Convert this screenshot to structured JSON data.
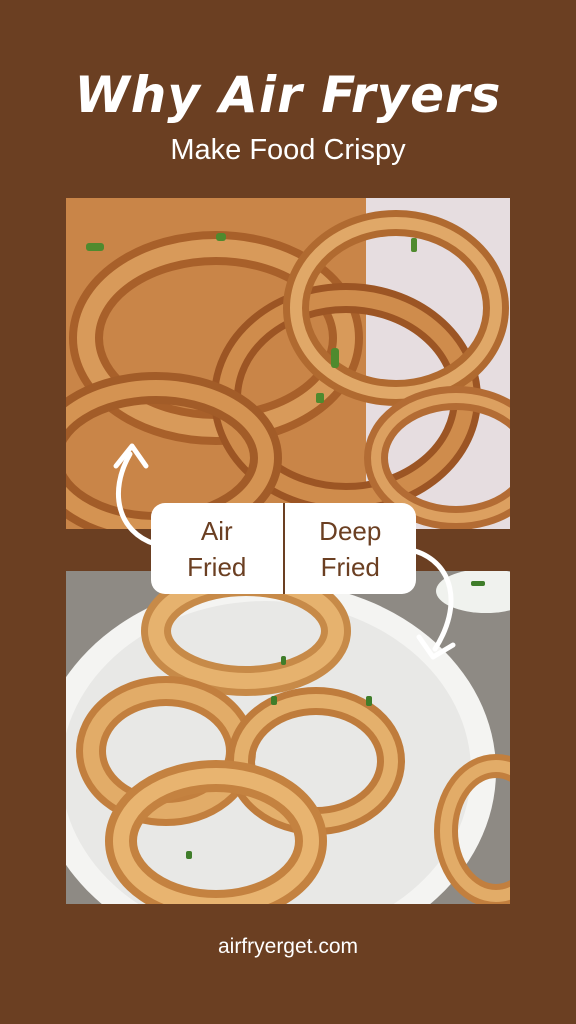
{
  "header": {
    "title": "Why Air Fryers",
    "subtitle": "Make Food Crispy"
  },
  "comparison": {
    "left_line1": "Air",
    "left_line2": "Fried",
    "right_line1": "Deep",
    "right_line2": "Fried"
  },
  "images": {
    "top": "deep-fried-onion-rings-photo",
    "bottom": "air-fried-onion-rings-photo"
  },
  "footer": {
    "website": "airfryerget.com"
  },
  "colors": {
    "background": "#6b3f22",
    "text": "#ffffff",
    "box": "#ffffff"
  }
}
